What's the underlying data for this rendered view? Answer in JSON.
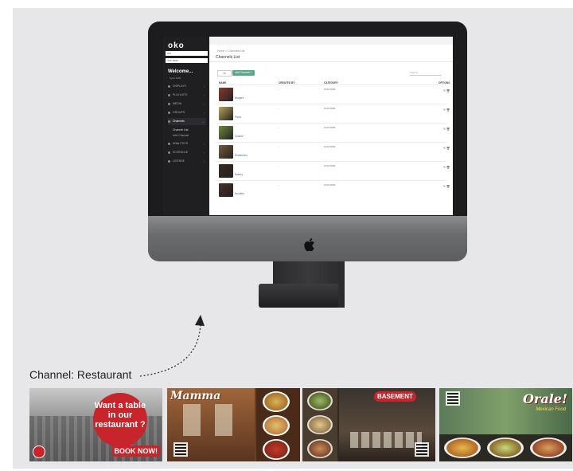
{
  "app": {
    "logo": "oko",
    "sidebar_inputs": [
      "RIC",
      "ICIC 0000"
    ],
    "welcome": "Welcome...",
    "welcome_sub": "Syed 1000",
    "menu": [
      {
        "label": "DISPLAYS"
      },
      {
        "label": "PLAYLISTS"
      },
      {
        "label": "MEDIA"
      },
      {
        "label": "GROUPS"
      },
      {
        "label": "Channels",
        "active": true
      },
      {
        "label": "ANALYTICS"
      },
      {
        "label": "SCHEDULE"
      },
      {
        "label": "LICENSE"
      }
    ],
    "submenu": [
      "Channel List",
      "Add Channel"
    ],
    "breadcrumb": "Home > Channels List",
    "page_title": "Channels List",
    "page_size": "10",
    "add_button": "Add Channel +",
    "search_label": "Search:",
    "columns": [
      "NAME",
      "CREATED BY",
      "CATEGORY",
      "OPTIONS"
    ],
    "rows": [
      {
        "name": "Burgers",
        "created_by": "-",
        "category": "ICICI 0000",
        "thumb_color": "#8b3a2b"
      },
      {
        "name": "Pizza",
        "created_by": "-",
        "category": "ICICI 0000",
        "thumb_color": "#b9a45a"
      },
      {
        "name": "Cuisine",
        "created_by": "-",
        "category": "ICICI 0000",
        "thumb_color": "#6e8a3a"
      },
      {
        "name": "Restaurant",
        "created_by": "-",
        "category": "ICICI 0000",
        "thumb_color": "#7a5b3a"
      },
      {
        "name": "Bakery",
        "created_by": "-",
        "category": "ICICI 0000",
        "thumb_color": "#3b2a1f"
      },
      {
        "name": "Noodles",
        "created_by": "-",
        "category": "ICICI 0000",
        "thumb_color": "#4b2e2a"
      }
    ],
    "option_icons": "✎ 🗑"
  },
  "caption": "Channel: Restaurant",
  "tiles": {
    "t1_badge": "Want a table in our restaurant ?",
    "t1_book": "BOOK NOW!",
    "t2_brand": "Mamma",
    "t3_brand": "BASEMENT",
    "t4_brand": "Orale!",
    "t4_sub": "Mexican Food"
  }
}
